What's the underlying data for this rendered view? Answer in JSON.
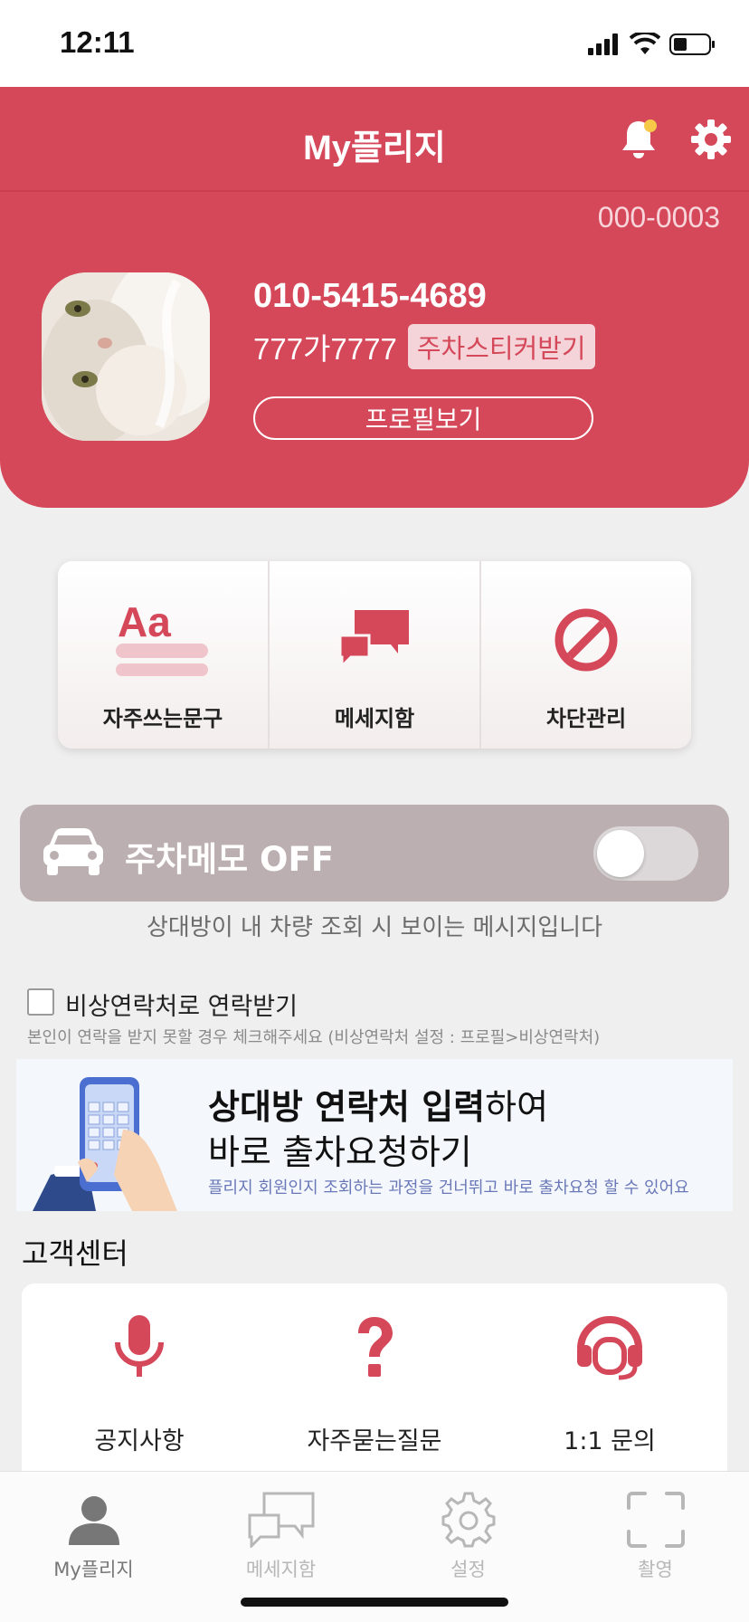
{
  "status_bar": {
    "time": "12:11"
  },
  "header": {
    "title": "My플리지",
    "member_no": "000-0003",
    "phone": "010-5415-4689",
    "plate": "777가7777",
    "sticker_label": "주차스티커받기",
    "profile_button": "프로필보기"
  },
  "quick_menu": [
    {
      "label": "자주쓰는문구",
      "icon": "text-phrases-icon"
    },
    {
      "label": "메세지함",
      "icon": "chat-bubbles-icon"
    },
    {
      "label": "차단관리",
      "icon": "block-icon"
    }
  ],
  "parking_memo": {
    "label": "주차메모 OFF",
    "toggle_on": false,
    "description": "상대방이 내 차량 조회 시 보이는 메시지입니다"
  },
  "emergency": {
    "label": "비상연락처로 연락받기",
    "checked": false,
    "note": "본인이 연락을 받지 못할 경우 체크해주세요 (비상연락처 설정 : 프로필>비상연락처)"
  },
  "banner": {
    "line1_bold": "상대방 연락처 입력",
    "line1_rest": "하여",
    "line2": "바로 출차요청하기",
    "note": "플리지 회원인지 조회하는 과정을 건너뛰고 바로 출차요청 할 수 있어요"
  },
  "customer_center": {
    "title": "고객센터",
    "items": [
      {
        "label": "공지사항",
        "icon": "microphone-icon"
      },
      {
        "label": "자주묻는질문",
        "icon": "question-icon"
      },
      {
        "label": "1:1 문의",
        "icon": "headset-icon"
      }
    ]
  },
  "tab_bar": [
    {
      "label": "My플리지",
      "active": true
    },
    {
      "label": "메세지함",
      "active": false
    },
    {
      "label": "설정",
      "active": false
    },
    {
      "label": "촬영",
      "active": false
    }
  ],
  "colors": {
    "brand": "#d5485a",
    "memo_bg": "#bbafb1",
    "background": "#f0efef"
  }
}
